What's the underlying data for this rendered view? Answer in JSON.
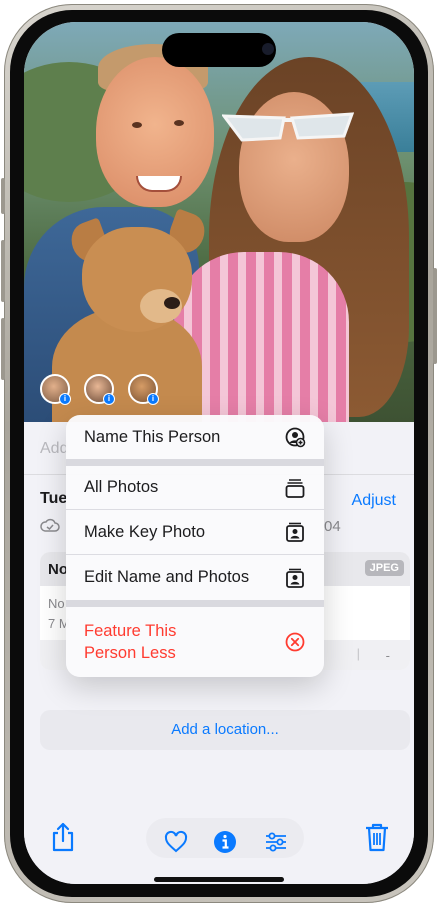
{
  "photo_sheet": {
    "caption_partial": "Add",
    "date_partial": "Tue",
    "adjust_label": "Adjust",
    "number_partial": "04",
    "file_card": {
      "title_partial": "No",
      "format_badge": "JPEG",
      "line1_partial": "No",
      "line2_partial": "7 M",
      "trailing_dash": "-",
      "separator": "|"
    },
    "add_location": "Add a location..."
  },
  "context_menu": {
    "items": [
      {
        "label": "Name This Person",
        "icon": "person-crop-circle-icon"
      },
      {
        "label": "All Photos",
        "icon": "rectangle-stack-icon"
      },
      {
        "label": "Make Key Photo",
        "icon": "person-rectangle-stack-icon"
      },
      {
        "label": "Edit Name and Photos",
        "icon": "person-rectangle-stack-icon"
      },
      {
        "label": "Feature This Person Less",
        "line1": "Feature This",
        "line2": "Person Less",
        "icon": "x-circle-icon",
        "destructive": true
      }
    ]
  },
  "people_chips": 3,
  "toolbar": {
    "icons": [
      "share-icon",
      "heart-icon",
      "info-icon",
      "adjust-sliders-icon",
      "trash-icon"
    ]
  },
  "colors": {
    "accent": "#0A7AFF",
    "destructive": "#FF3B30",
    "sheet_background": "#F2F2F7"
  }
}
